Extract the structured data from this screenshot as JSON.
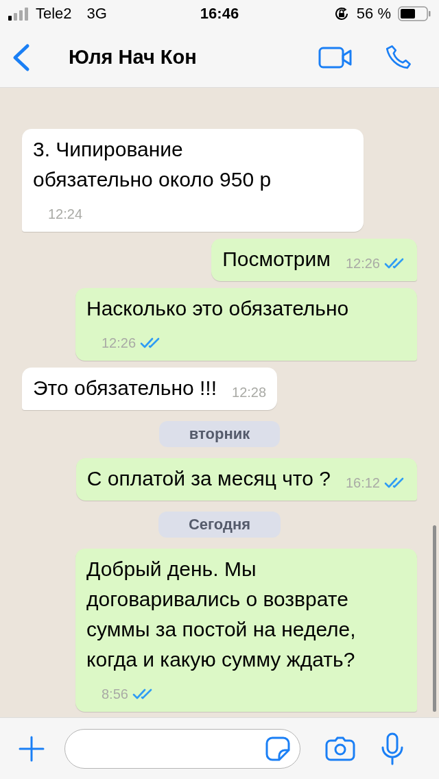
{
  "status_bar": {
    "carrier": "Tele2",
    "network": "3G",
    "time": "16:46",
    "battery": "56 %"
  },
  "header": {
    "title": "Юля Нач Кон"
  },
  "messages": [
    {
      "kind": "incoming",
      "text": "3. Чипирование обязательно около 950 р",
      "time": "12:24"
    },
    {
      "kind": "outgoing",
      "text": "Посмотрим",
      "time": "12:26",
      "read": true
    },
    {
      "kind": "outgoing",
      "text": "Насколько это обязательно",
      "time": "12:26",
      "read": true
    },
    {
      "kind": "incoming",
      "text": "Это обязательно !!!",
      "time": "12:28"
    },
    {
      "kind": "date",
      "text": "вторник"
    },
    {
      "kind": "outgoing",
      "text": "С оплатой за месяц что ?",
      "time": "16:12",
      "read": true
    },
    {
      "kind": "date",
      "text": "Сегодня"
    },
    {
      "kind": "outgoing",
      "text": "Добрый день. Мы договаривались о возврате суммы за постой на неделе, когда и какую сумму ждать?",
      "time": "8:56",
      "read": true
    }
  ]
}
